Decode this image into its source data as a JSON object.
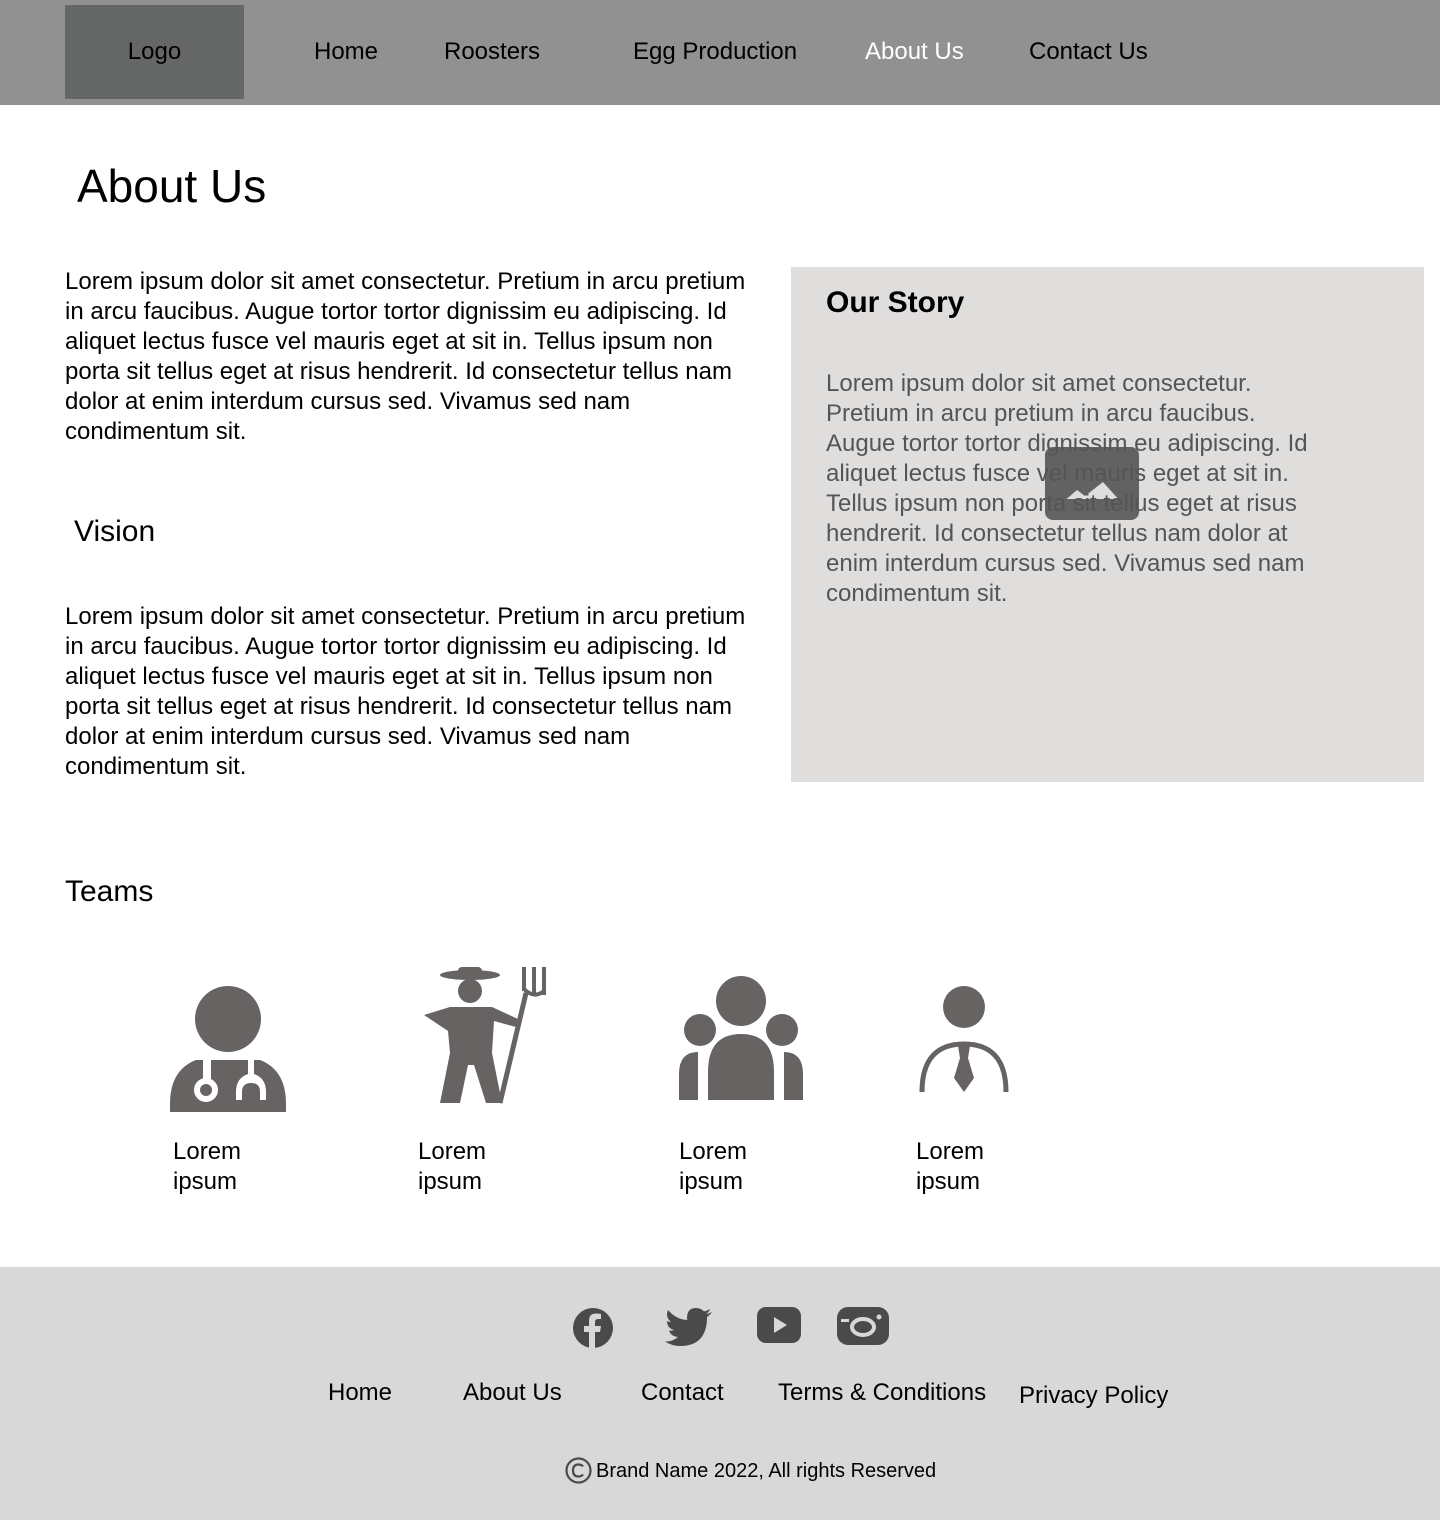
{
  "header": {
    "logo": "Logo",
    "nav": [
      "Home",
      "Roosters",
      "Egg Production",
      "About Us",
      "Contact Us"
    ],
    "active": "About Us"
  },
  "page_title": "About Us",
  "intro_text": "Lorem ipsum dolor sit amet consectetur. Pretium in arcu pretium in arcu faucibus. Augue tortor tortor dignissim eu adipiscing. Id aliquet lectus fusce vel mauris eget at sit in. Tellus ipsum non porta sit tellus eget at risus hendrerit. Id consectetur tellus nam dolor at enim interdum cursus sed. Vivamus sed nam condimentum sit.",
  "vision": {
    "heading": "Vision",
    "text": "Lorem ipsum dolor sit amet consectetur. Pretium in arcu pretium in arcu faucibus. Augue tortor tortor dignissim eu adipiscing. Id aliquet lectus fusce vel mauris eget at sit in. Tellus ipsum non porta sit tellus eget at risus hendrerit. Id consectetur tellus nam dolor at enim interdum cursus sed. Vivamus sed nam condimentum sit."
  },
  "story": {
    "title": "Our Story",
    "text": "Lorem ipsum dolor sit amet consectetur. Pretium in arcu pretium in arcu faucibus. Augue tortor tortor dignissim eu adipiscing. Id aliquet lectus fusce vel mauris eget at sit in. Tellus ipsum non porta sit tellus eget at risus hendrerit. Id consectetur tellus nam dolor at enim interdum cursus sed. Vivamus sed nam condimentum sit.",
    "image_icon": "image-placeholder-icon"
  },
  "teams": {
    "heading": "Teams",
    "members": [
      {
        "icon": "doctor-icon",
        "label": "Lorem ipsum"
      },
      {
        "icon": "farmer-icon",
        "label": "Lorem ipsum"
      },
      {
        "icon": "group-icon",
        "label": "Lorem ipsum"
      },
      {
        "icon": "businessman-icon",
        "label": "Lorem ipsum"
      }
    ]
  },
  "footer": {
    "social": [
      "facebook-icon",
      "twitter-icon",
      "youtube-icon",
      "instagram-icon"
    ],
    "links": [
      "Home",
      "About Us",
      "Contact",
      "Terms & Conditions",
      "Privacy Policy"
    ],
    "copyright": "Brand Name 2022, All rights Reserved"
  },
  "colors": {
    "header_bg": "#919191",
    "logo_bg": "#646766",
    "story_bg": "#e0dddd",
    "footer_bg": "#d8d8d8",
    "icon": "#676363"
  }
}
